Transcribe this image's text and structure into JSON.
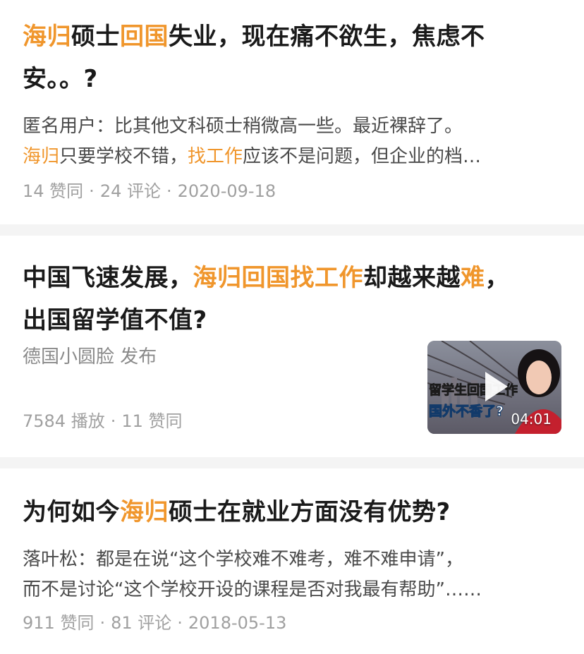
{
  "feed": {
    "items": [
      {
        "title_parts": [
          {
            "text": "海归",
            "hl": true
          },
          {
            "text": "硕士",
            "hl": false
          },
          {
            "text": "回国",
            "hl": true
          },
          {
            "text": "失业，现在痛不欲生，焦虑不",
            "hl": false
          }
        ],
        "title_line2": "安。。?",
        "excerpt_line1": "匿名用户：比其他文科硕士稍微高一些。最近裸辞了。",
        "excerpt_line2_parts": [
          {
            "text": "海归",
            "hl": true
          },
          {
            "text": "只要学校不错，",
            "hl": false
          },
          {
            "text": "找工作",
            "hl": true
          },
          {
            "text": "应该不是问题，但企业的档…",
            "hl": false
          }
        ],
        "likes": "14 赞同",
        "comments": "24 评论",
        "date": "2020-09-18",
        "sep": "·"
      },
      {
        "title_parts": [
          {
            "text": "中国飞速发展，",
            "hl": false
          },
          {
            "text": "海归回国找工作",
            "hl": true
          },
          {
            "text": "却越来越",
            "hl": false
          },
          {
            "text": "难",
            "hl": true
          },
          {
            "text": "，",
            "hl": false
          }
        ],
        "title_line2": "出国留学值不值?",
        "author": "德国小圆脸 发布",
        "plays": "7584 播放",
        "likes": "11 赞同",
        "sep": "·",
        "thumbnail": {
          "caption_line1": "留学生回国工作",
          "caption_line2": "国外不香了?",
          "duration": "04:01"
        }
      },
      {
        "title_parts": [
          {
            "text": "为何如今",
            "hl": false
          },
          {
            "text": "海归",
            "hl": true
          },
          {
            "text": "硕士在就业方面没有优势?",
            "hl": false
          }
        ],
        "excerpt_line1": "落叶松：都是在说“这个学校难不难考，难不难申请”，",
        "excerpt_line2": "而不是讨论“这个学校开设的课程是否对我最有帮助”……",
        "likes": "911 赞同",
        "comments": "81 评论",
        "date": "2018-05-13",
        "sep": "·"
      }
    ]
  },
  "colors": {
    "highlight": "#f0962c",
    "title": "#1a1a1a",
    "excerpt": "#4a4a4a",
    "meta": "#a0a0a0",
    "divider": "#f4f4f4"
  },
  "icons": {
    "play": "play-icon"
  }
}
